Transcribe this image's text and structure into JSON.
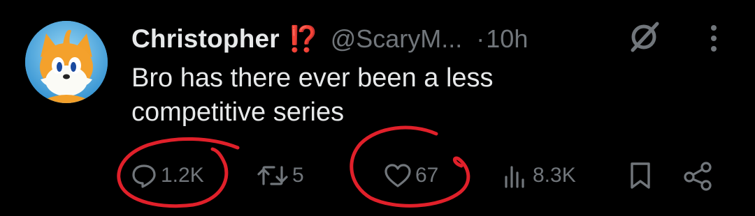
{
  "tweet": {
    "display_name": "Christopher",
    "name_emoji": "⁉️",
    "handle": "@ScaryM...",
    "separator": "·",
    "time": "10h",
    "text": "Bro has there ever been a less competitive series"
  },
  "actions": {
    "replies": "1.2K",
    "retweets": "5",
    "likes": "67",
    "views": "8.3K"
  },
  "icons": {
    "reply": "reply-icon",
    "retweet": "retweet-icon",
    "like": "heart-icon",
    "views": "views-icon",
    "bookmark": "bookmark-icon",
    "share": "share-icon",
    "grok": "grok-icon",
    "more": "more-icon"
  },
  "colors": {
    "background": "#000000",
    "text": "#e7e9ea",
    "secondary": "#71767b",
    "annotation": "#e0202a"
  }
}
